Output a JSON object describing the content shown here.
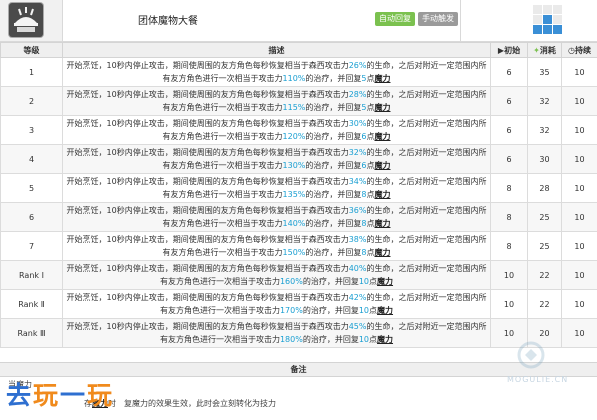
{
  "skill": {
    "name": "团体魔物大餐",
    "icon": "skill-icon-cooking",
    "tags": [
      "自动回复",
      "手动触发"
    ]
  },
  "columns": {
    "level": "等级",
    "description": "描述",
    "initial": "初始",
    "cost": "消耗",
    "duration": "持续"
  },
  "column_icons": {
    "initial": "play-icon",
    "cost": "bolt-icon",
    "duration": "clock-icon"
  },
  "rows": [
    {
      "level": "1",
      "pct": "26%",
      "pct2": "110%",
      "recover": "5",
      "initial": "6",
      "cost": "35",
      "duration": "10"
    },
    {
      "level": "2",
      "pct": "28%",
      "pct2": "115%",
      "recover": "5",
      "initial": "6",
      "cost": "32",
      "duration": "10"
    },
    {
      "level": "3",
      "pct": "30%",
      "pct2": "120%",
      "recover": "6",
      "initial": "6",
      "cost": "32",
      "duration": "10"
    },
    {
      "level": "4",
      "pct": "32%",
      "pct2": "130%",
      "recover": "6",
      "initial": "6",
      "cost": "30",
      "duration": "10"
    },
    {
      "level": "5",
      "pct": "34%",
      "pct2": "135%",
      "recover": "8",
      "initial": "8",
      "cost": "28",
      "duration": "10"
    },
    {
      "level": "6",
      "pct": "36%",
      "pct2": "140%",
      "recover": "8",
      "initial": "8",
      "cost": "25",
      "duration": "10"
    },
    {
      "level": "7",
      "pct": "38%",
      "pct2": "150%",
      "recover": "8",
      "initial": "8",
      "cost": "25",
      "duration": "10"
    },
    {
      "level": "Rank Ⅰ",
      "pct": "40%",
      "pct2": "160%",
      "recover": "10",
      "initial": "10",
      "cost": "22",
      "duration": "10"
    },
    {
      "level": "Rank Ⅱ",
      "pct": "42%",
      "pct2": "170%",
      "recover": "10",
      "initial": "10",
      "cost": "22",
      "duration": "10"
    },
    {
      "level": "Rank Ⅲ",
      "pct": "45%",
      "pct2": "180%",
      "recover": "10",
      "initial": "10",
      "cost": "20",
      "duration": "10"
    }
  ],
  "desc_parts": {
    "a": "开始烹饪，10秒内停止攻击，期间使周围的友方角色每秒恢复相当于森西攻击力",
    "b": "的生命，之后对附近一定范围内所有友方角色进行一次相当于攻击力",
    "c": "的治疗，并回复",
    "d": "点",
    "e": "魔力"
  },
  "notes": {
    "title": "备注",
    "lines": [
      "当魔力",
      "复魔力的效果生效，此时会立刻转化为技力"
    ],
    "line2_fragments": [
      "状态",
      "存",
      "魔力",
      "时"
    ]
  },
  "brand": {
    "logo_text": [
      "去",
      "玩",
      "一",
      "玩"
    ],
    "watermark": "MOGULIE.CN"
  },
  "colors": {
    "accent": "#1a9fd2",
    "tag_auto": "#7bc14f",
    "tag_manual": "#9a9a9a",
    "range_grid": "#3a8fd6"
  }
}
